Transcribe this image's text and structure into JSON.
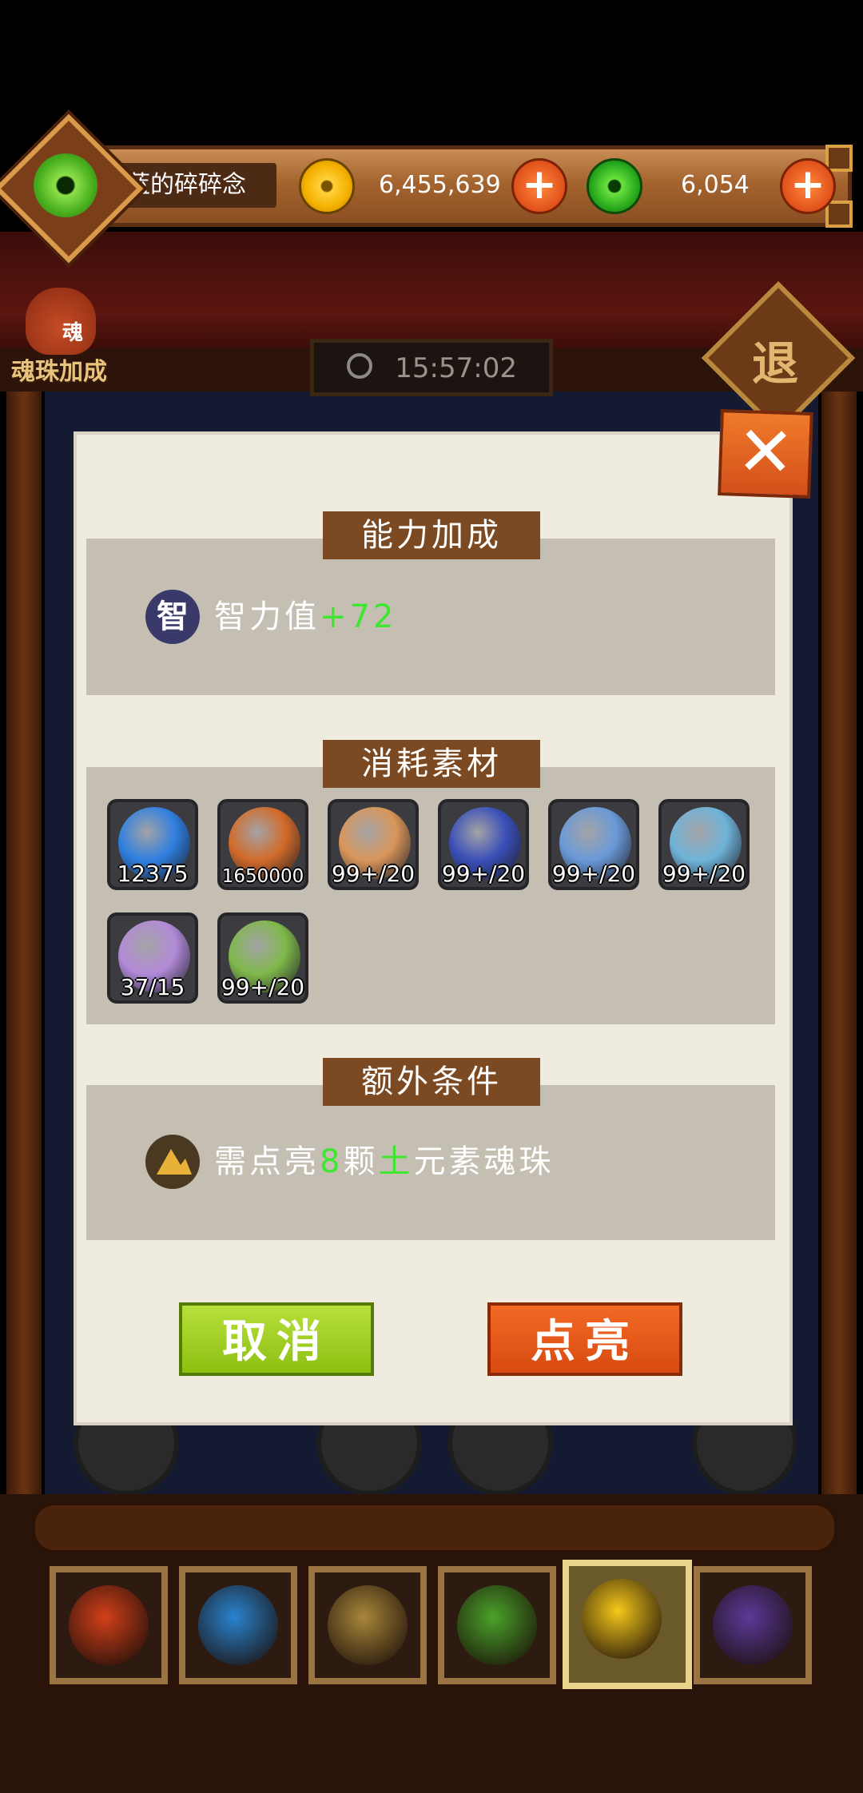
{
  "top_bar": {
    "player_name": "蓝的碎碎念",
    "coins": "6,455,639",
    "jade": "6,054",
    "plus_label": "+"
  },
  "scene": {
    "bonus_label": "魂珠加成",
    "bonus_bag_glyph": "魂",
    "timer": "15:57:02",
    "exit_label": "退"
  },
  "dialog": {
    "close_label": "✕",
    "ability_title": "能力加成",
    "ability": {
      "icon_glyph": "智",
      "name": "智力值",
      "value": "+72"
    },
    "materials_title": "消耗素材",
    "materials": [
      {
        "count": "12375",
        "icon": "blue-flame-icon",
        "color": "#2f7fe0"
      },
      {
        "count": "1650000",
        "icon": "gold-pot-icon",
        "color": "#d26a2a"
      },
      {
        "count": "99+/20",
        "icon": "fire-rune-orb-icon",
        "color": "#d9965a"
      },
      {
        "count": "99+/20",
        "icon": "water-rune-orb-icon",
        "color": "#3a4fb8"
      },
      {
        "count": "99+/20",
        "icon": "ice-rune-orb-icon",
        "color": "#6a9ad8"
      },
      {
        "count": "99+/20",
        "icon": "eye-rune-orb-icon",
        "color": "#6fb3d9"
      },
      {
        "count": "37/15",
        "icon": "spirit-book-orb-icon",
        "color": "#b28ad8"
      },
      {
        "count": "99+/20",
        "icon": "clover-rune-orb-icon",
        "color": "#7fb84a"
      }
    ],
    "extra_title": "额外条件",
    "condition": {
      "prefix": "需点亮",
      "count": "8",
      "mid": "颗",
      "element": "土",
      "suffix": "元素魂珠"
    },
    "cancel_label": "取消",
    "confirm_label": "点亮"
  },
  "element_slots": [
    {
      "name": "fire-element-icon",
      "color": "#d2401a"
    },
    {
      "name": "water-element-icon",
      "color": "#2a84d0"
    },
    {
      "name": "earth-element-icon",
      "color": "#a8873a"
    },
    {
      "name": "wood-element-icon",
      "color": "#4aa22a"
    },
    {
      "name": "light-element-icon",
      "color": "#f4c81a",
      "active": true
    },
    {
      "name": "dark-element-icon",
      "color": "#5a3a9a"
    }
  ]
}
